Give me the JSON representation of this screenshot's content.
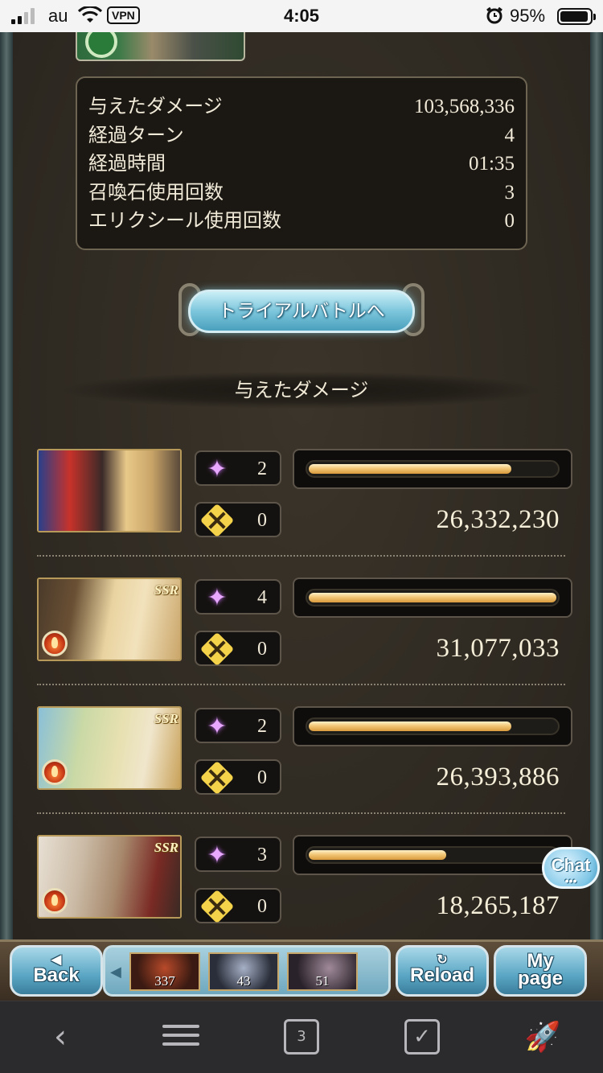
{
  "status_bar": {
    "carrier": "au",
    "vpn": "VPN",
    "time": "4:05",
    "battery": "95%",
    "battery_level": 0.95
  },
  "summary": {
    "rows": [
      {
        "label": "与えたダメージ",
        "value": "103,568,336"
      },
      {
        "label": "経過ターン",
        "value": "4"
      },
      {
        "label": "経過時間",
        "value": "01:35"
      },
      {
        "label": "召喚石使用回数",
        "value": "3"
      },
      {
        "label": "エリクシール使用回数",
        "value": "0"
      }
    ]
  },
  "trial_button": {
    "label": "トライアルバトルへ"
  },
  "damage_section": {
    "title": "与えたダメージ"
  },
  "characters": [
    {
      "charge_attacks": "2",
      "ougi_count": "0",
      "damage": "26,332,230",
      "share": 0.82,
      "rarity": "",
      "element": ""
    },
    {
      "charge_attacks": "4",
      "ougi_count": "0",
      "damage": "31,077,033",
      "share": 1.0,
      "rarity": "SSR",
      "element": "fire"
    },
    {
      "charge_attacks": "2",
      "ougi_count": "0",
      "damage": "26,393,886",
      "share": 0.82,
      "rarity": "SSR",
      "element": "fire"
    },
    {
      "charge_attacks": "3",
      "ougi_count": "0",
      "damage": "18,265,187",
      "share": 0.56,
      "rarity": "SSR",
      "element": "fire"
    }
  ],
  "chat_button": {
    "label": "Chat",
    "dots": "•••"
  },
  "game_nav": {
    "back": "Back",
    "reload": "Reload",
    "mypage_line1": "My",
    "mypage_line2": "page",
    "quests": [
      {
        "count": "337"
      },
      {
        "count": "43"
      },
      {
        "count": "51"
      }
    ]
  },
  "browser_toolbar": {
    "tab_count": "3",
    "icons": [
      "back-icon",
      "menu-icon",
      "tabs-icon",
      "bookmark-check-icon",
      "rocket-icon"
    ]
  },
  "colors": {
    "panel_bg": "#2f2a22",
    "bar_fill": "#f2c777",
    "button_blue": "#7cc6dc"
  }
}
